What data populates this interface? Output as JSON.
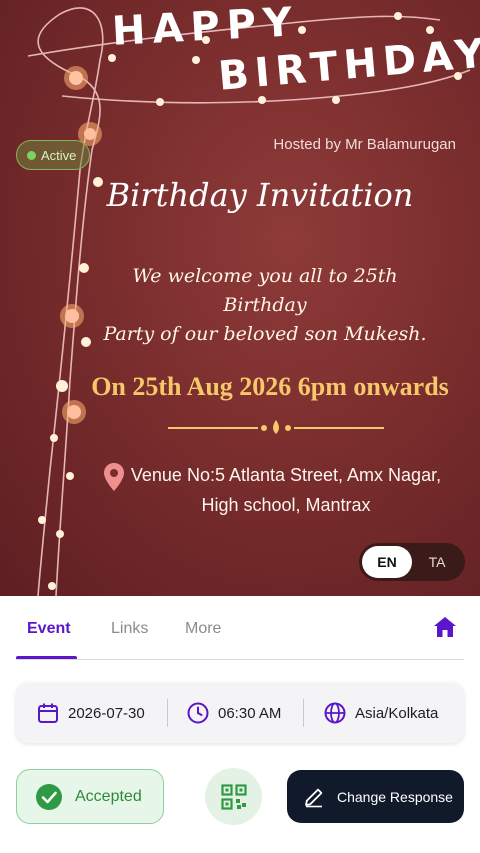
{
  "hero": {
    "happy_text": "HAPPY",
    "birthday_text": "BIRTHDAY",
    "hosted_by": "Hosted by Mr Balamurugan",
    "status_badge": "Active",
    "invitation_title": "Birthday Invitation",
    "welcome_line1": "We welcome you all to 25th Birthday",
    "welcome_line2": "Party of our beloved son Mukesh.",
    "date_line": "On 25th Aug 2026 6pm onwards",
    "venue_line1": "Venue No:5 Atlanta Street, Amx Nagar,",
    "venue_line2": "High school, Mantrax",
    "lang_en": "EN",
    "lang_ta": "TA",
    "lang_selected": "EN"
  },
  "tabs": {
    "items": [
      {
        "label": "Event",
        "active": true
      },
      {
        "label": "Links",
        "active": false
      },
      {
        "label": "More",
        "active": false
      }
    ],
    "home_icon": "home-icon"
  },
  "info": {
    "date": "2026-07-30",
    "time": "06:30 AM",
    "timezone": "Asia/Kolkata",
    "icons": [
      "calendar-icon",
      "clock-icon",
      "globe-icon"
    ]
  },
  "actions": {
    "accepted_label": "Accepted",
    "qr_icon": "qr-code-icon",
    "change_label": "Change Response"
  },
  "colors": {
    "accent": "#5b16c9",
    "hero_bg": "#7a2d2d",
    "gold": "#f6c86a",
    "accepted_green": "#2e8a3a",
    "dark_button": "#111a2b"
  }
}
